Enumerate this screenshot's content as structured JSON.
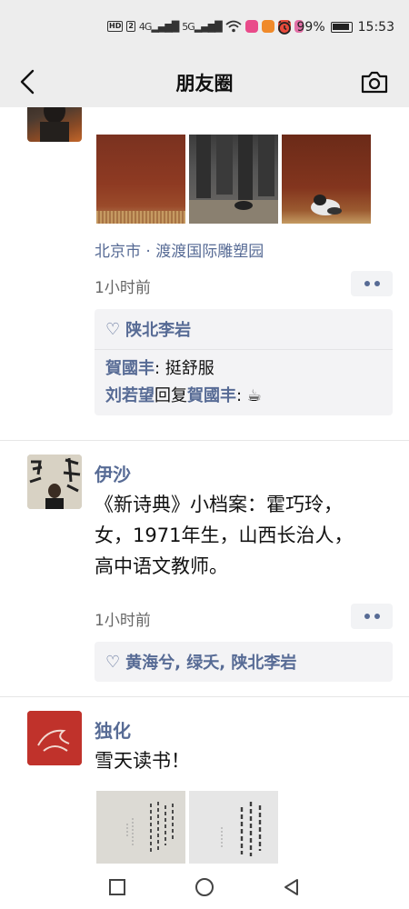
{
  "status_bar": {
    "hd_badge": "HD",
    "sim2": "2",
    "sig1": "4G",
    "sig2": "5G",
    "battery": "99%",
    "time": "15:53"
  },
  "nav": {
    "title": "朋友圈"
  },
  "posts": [
    {
      "location": "北京市 · 渡渡国际雕塑园",
      "time": "1小时前",
      "likes": "陕北李岩",
      "comments": [
        {
          "author": "賀國丰",
          "sep": ": ",
          "text": "挺舒服"
        },
        {
          "author": "刘若望",
          "reply_word": "回复",
          "reply_to": "賀國丰",
          "sep": ": ",
          "text": "☕"
        }
      ]
    },
    {
      "name": "伊沙",
      "text": "《新诗典》小档案：霍巧玲，女，1971年生，山西长治人，高中语文教师。",
      "time": "1小时前",
      "likes": "黄海兮, 绿夭, 陕北李岩"
    },
    {
      "name": "独化",
      "text": "雪天读书！"
    }
  ],
  "colors": {
    "link": "#576b95",
    "bar_bg": "#ededed",
    "interact_bg": "#f3f3f5"
  }
}
